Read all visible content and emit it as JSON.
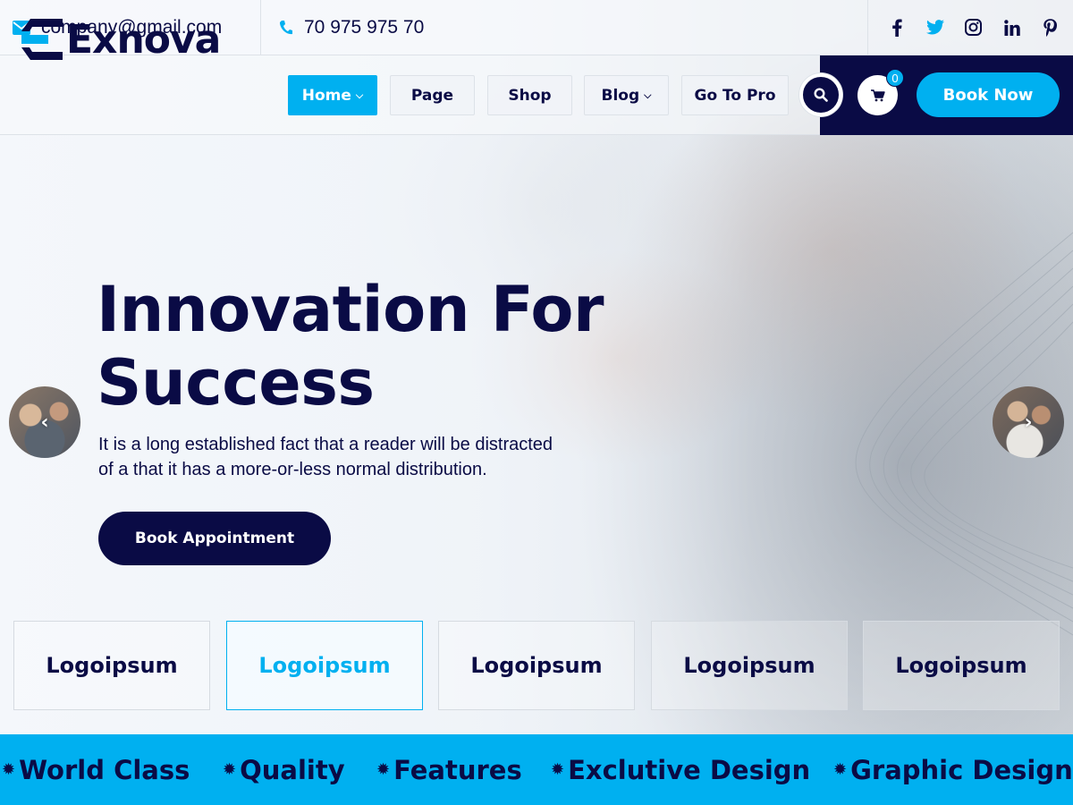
{
  "topbar": {
    "email": "company@gmail.com",
    "phone": "70 975 975 70",
    "socials": [
      "facebook-icon",
      "twitter-icon",
      "instagram-icon",
      "linkedin-icon",
      "pinterest-icon"
    ]
  },
  "brand": {
    "name": "Exnova"
  },
  "nav": {
    "items": [
      {
        "label": "Home",
        "active": true,
        "dropdown": true
      },
      {
        "label": "Page",
        "active": false,
        "dropdown": false
      },
      {
        "label": "Shop",
        "active": false,
        "dropdown": false
      },
      {
        "label": "Blog",
        "active": false,
        "dropdown": true
      },
      {
        "label": "Go To Pro",
        "active": false,
        "dropdown": false
      }
    ],
    "cart_count": "0",
    "book_now": "Book Now"
  },
  "hero": {
    "title_line1": "Innovation For",
    "title_line2": "Success",
    "description_line1": "It is a long established fact that a reader will be distracted",
    "description_line2": "of a that it has a more-or-less normal distribution.",
    "cta": "Book Appointment",
    "prev_glyph": "‹",
    "next_glyph": "›"
  },
  "partners": [
    "Logoipsum",
    "Logoipsum",
    "Logoipsum",
    "Logoipsum",
    "Logoipsum"
  ],
  "marquee": [
    "World Class",
    "Quality",
    "Features",
    "Exclutive Design",
    "Graphic Design"
  ],
  "colors": {
    "primary": "#0a0b45",
    "accent": "#00b0f0",
    "white": "#ffffff"
  }
}
